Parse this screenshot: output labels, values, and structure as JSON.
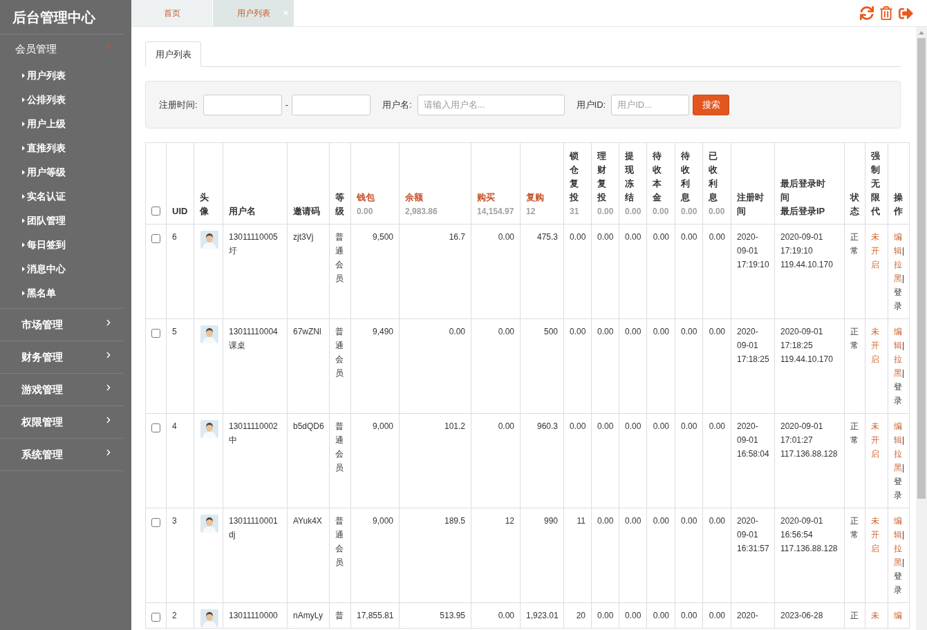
{
  "sidebar": {
    "title": "后台管理中心",
    "groups": [
      {
        "label": "会员管理",
        "expanded": true,
        "children": [
          {
            "label": "用户列表"
          },
          {
            "label": "公排列表"
          },
          {
            "label": "用户上级"
          },
          {
            "label": "直推列表"
          },
          {
            "label": "用户等级"
          },
          {
            "label": "实名认证"
          },
          {
            "label": "团队管理"
          },
          {
            "label": "每日签到"
          },
          {
            "label": "消息中心"
          },
          {
            "label": "黑名单"
          }
        ]
      },
      {
        "label": "市场管理",
        "expanded": false
      },
      {
        "label": "财务管理",
        "expanded": false
      },
      {
        "label": "游戏管理",
        "expanded": false
      },
      {
        "label": "权限管理",
        "expanded": false
      },
      {
        "label": "系统管理",
        "expanded": false
      }
    ]
  },
  "tabs": [
    {
      "label": "首页",
      "selected": false,
      "closable": false
    },
    {
      "label": "用户列表",
      "selected": true,
      "closable": true
    }
  ],
  "page_tab": {
    "label": "用户列表"
  },
  "search": {
    "fields": [
      {
        "kind": "date_range",
        "label": "注册时间:",
        "separator": "-"
      },
      {
        "kind": "text",
        "label": "用户名:",
        "placeholder": "请输入用户名..."
      },
      {
        "kind": "text",
        "label": "用户ID:",
        "placeholder": "用户ID..."
      }
    ],
    "button": "搜索"
  },
  "table": {
    "select_all": {
      "checked": false
    },
    "columns": [
      {
        "label": "UID",
        "highlight": false
      },
      {
        "label": "头像",
        "highlight": false
      },
      {
        "label": "用户名",
        "highlight": false
      },
      {
        "label": "邀请码",
        "highlight": false
      },
      {
        "label": "等级",
        "highlight": false
      },
      {
        "label": "钱包",
        "highlight": true,
        "total": "0.00"
      },
      {
        "label": "余额",
        "highlight": true,
        "total": "2,983.86"
      },
      {
        "label": "购买",
        "highlight": true,
        "total": "14,154.97"
      },
      {
        "label": "复购",
        "highlight": true,
        "total": "12"
      },
      {
        "label": "锁仓复投",
        "highlight": false,
        "total": "31"
      },
      {
        "label": "理财复投",
        "highlight": false,
        "total": "0.00"
      },
      {
        "label": "提现冻结",
        "highlight": false,
        "total": "0.00"
      },
      {
        "label": "待收本金",
        "highlight": false,
        "total": "0.00"
      },
      {
        "label": "待收利息",
        "highlight": false,
        "total": "0.00"
      },
      {
        "label": "已收利息",
        "highlight": false,
        "total": "0.00"
      },
      {
        "label": "注册时间",
        "highlight": false
      },
      {
        "label": "最后登录时间",
        "label_2": "最后登录IP",
        "highlight": false
      },
      {
        "label": "状态",
        "highlight": false
      },
      {
        "label": "强制无限代",
        "highlight": false
      },
      {
        "label": "操作",
        "highlight": false
      }
    ],
    "rows": [
      {
        "checked": false,
        "uid": "6",
        "username": "13011110005",
        "nickname": "圩",
        "invite_code": "zjt3Vj",
        "level": "普通会员",
        "amounts": [
          "9,500",
          "16.7",
          "0.00",
          "475.3",
          "0.00",
          "0.00",
          "0.00",
          "0.00",
          "0.00",
          "0.00"
        ],
        "registered": "2020-09-01 17:19:10",
        "last_login": "2020-09-01 17:19:10",
        "last_ip": "119.44.10.170",
        "status": "正常",
        "unlimited": "未开启",
        "actions": [
          {
            "kind": "link",
            "label": "编辑"
          },
          {
            "kind": "separator",
            "label": "|"
          },
          {
            "kind": "link",
            "label": "拉黑"
          },
          {
            "kind": "separator",
            "label": "|"
          },
          {
            "kind": "plain_link",
            "label": "登录"
          }
        ]
      },
      {
        "checked": false,
        "uid": "5",
        "username": "13011110004",
        "nickname": "课桌",
        "invite_code": "67wZNl",
        "level": "普通会员",
        "amounts": [
          "9,490",
          "0.00",
          "0.00",
          "500",
          "0.00",
          "0.00",
          "0.00",
          "0.00",
          "0.00",
          "0.00"
        ],
        "registered": "2020-09-01 17:18:25",
        "last_login": "2020-09-01 17:18:25",
        "last_ip": "119.44.10.170",
        "status": "正常",
        "unlimited": "未开启",
        "actions": [
          {
            "kind": "link",
            "label": "编辑"
          },
          {
            "kind": "separator",
            "label": "|"
          },
          {
            "kind": "link",
            "label": "拉黑"
          },
          {
            "kind": "separator",
            "label": "|"
          },
          {
            "kind": "plain_link",
            "label": "登录"
          }
        ]
      },
      {
        "checked": false,
        "uid": "4",
        "username": "13011110002",
        "nickname": "中",
        "invite_code": "b5dQD6",
        "level": "普通会员",
        "amounts": [
          "9,000",
          "101.2",
          "0.00",
          "960.3",
          "0.00",
          "0.00",
          "0.00",
          "0.00",
          "0.00",
          "0.00"
        ],
        "registered": "2020-09-01 16:58:04",
        "last_login": "2020-09-01 17:01:27",
        "last_ip": "117.136.88.128",
        "status": "正常",
        "unlimited": "未开启",
        "actions": [
          {
            "kind": "link",
            "label": "编辑"
          },
          {
            "kind": "separator",
            "label": "|"
          },
          {
            "kind": "link",
            "label": "拉黑"
          },
          {
            "kind": "separator",
            "label": "|"
          },
          {
            "kind": "plain_link",
            "label": "登录"
          }
        ]
      },
      {
        "checked": false,
        "uid": "3",
        "username": "13011110001",
        "nickname": "dj",
        "invite_code": "AYuk4X",
        "level": "普通会员",
        "amounts": [
          "9,000",
          "189.5",
          "12",
          "990",
          "11",
          "0.00",
          "0.00",
          "0.00",
          "0.00",
          "0.00"
        ],
        "registered": "2020-09-01 16:31:57",
        "last_login": "2020-09-01 16:56:54",
        "last_ip": "117.136.88.128",
        "status": "正常",
        "unlimited": "未开启",
        "actions": [
          {
            "kind": "link",
            "label": "编辑"
          },
          {
            "kind": "separator",
            "label": "|"
          },
          {
            "kind": "link",
            "label": "拉黑"
          },
          {
            "kind": "separator",
            "label": "|"
          },
          {
            "kind": "plain_link",
            "label": "登录"
          }
        ]
      },
      {
        "checked": false,
        "uid": "2",
        "username": "13011110000",
        "invite_code": "nAmyLy",
        "level": "普",
        "amounts": [
          "17,855.81",
          "513.95",
          "0.00",
          "1,923.01",
          "20",
          "0.00",
          "0.00",
          "0.00",
          "0.00",
          "0.00"
        ],
        "registered": "2020-",
        "last_login": "2023-06-28",
        "status": "正",
        "unlimited": "未",
        "actions": [
          {
            "kind": "link",
            "label": "编"
          }
        ]
      }
    ]
  }
}
